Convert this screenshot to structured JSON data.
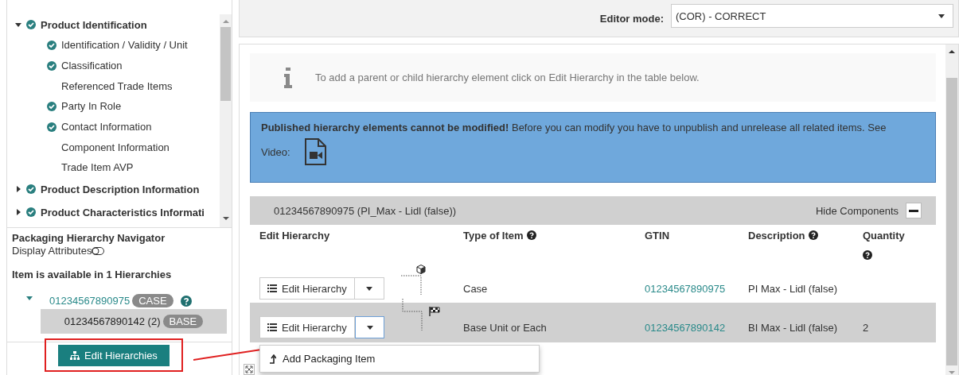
{
  "tree": {
    "items": [
      {
        "label": "Product Identification",
        "checked": true,
        "expanded": true,
        "children": [
          {
            "label": "Identification / Validity / Unit",
            "checked": true
          },
          {
            "label": "Classification",
            "checked": true
          },
          {
            "label": "Referenced Trade Items",
            "checked": false
          },
          {
            "label": "Party In Role",
            "checked": true
          },
          {
            "label": "Contact Information",
            "checked": true
          },
          {
            "label": "Component Information",
            "checked": false
          },
          {
            "label": "Trade Item AVP",
            "checked": false
          }
        ]
      },
      {
        "label": "Product Description Information",
        "checked": true,
        "expanded": false
      },
      {
        "label": "Product Characteristics Informati",
        "checked": true,
        "expanded": false
      }
    ]
  },
  "navigator": {
    "title": "Packaging Hierarchy Navigator",
    "display_attributes": "Display Attributes",
    "display_attributes_on": false,
    "availability": "Item is available in 1 Hierarchies",
    "root": {
      "gtin": "01234567890975",
      "badge": "CASE",
      "expanded": true
    },
    "child": {
      "label": "01234567890142 (2)",
      "badge": "BASE",
      "selected": true
    },
    "button": "Edit Hierarchies"
  },
  "editor_mode": {
    "label": "Editor mode:",
    "value": "(COR) - CORRECT"
  },
  "info": {
    "text": "To add a parent or child hierarchy element click on Edit Hierarchy in the table below."
  },
  "warning": {
    "text": "**Published hierarchy elements cannot be modified!** Before you can modify you have to unpublish and unrelease all related items.  See",
    "video_label": "Video:"
  },
  "hierarchy_table": {
    "title": "01234567890975 (PI_Max - Lidl (false))",
    "hide_components": "Hide Components",
    "columns": [
      {
        "label": "Edit Hierarchy",
        "help": false
      },
      {
        "label": "Type of Item",
        "help": true
      },
      {
        "label": "GTIN",
        "help": false
      },
      {
        "label": "Description",
        "help": true
      },
      {
        "label": "Quantity",
        "help": true
      }
    ],
    "rows": [
      {
        "kind": "case",
        "edit_button": "Edit Hierarchy",
        "menu_open": false,
        "selected": false,
        "type": "Case",
        "gtin": "01234567890975",
        "description": "PI  Max - Lidl (false)",
        "quantity": ""
      },
      {
        "kind": "base",
        "edit_button": "Edit Hierarchy",
        "menu_open": true,
        "selected": true,
        "type": "Base Unit or Each",
        "gtin": "01234567890142",
        "description": "BI  Max - Lidl (false)",
        "quantity": "2"
      }
    ]
  },
  "dropdown_menu": {
    "items": [
      {
        "label": "Add Packaging Item"
      }
    ]
  }
}
